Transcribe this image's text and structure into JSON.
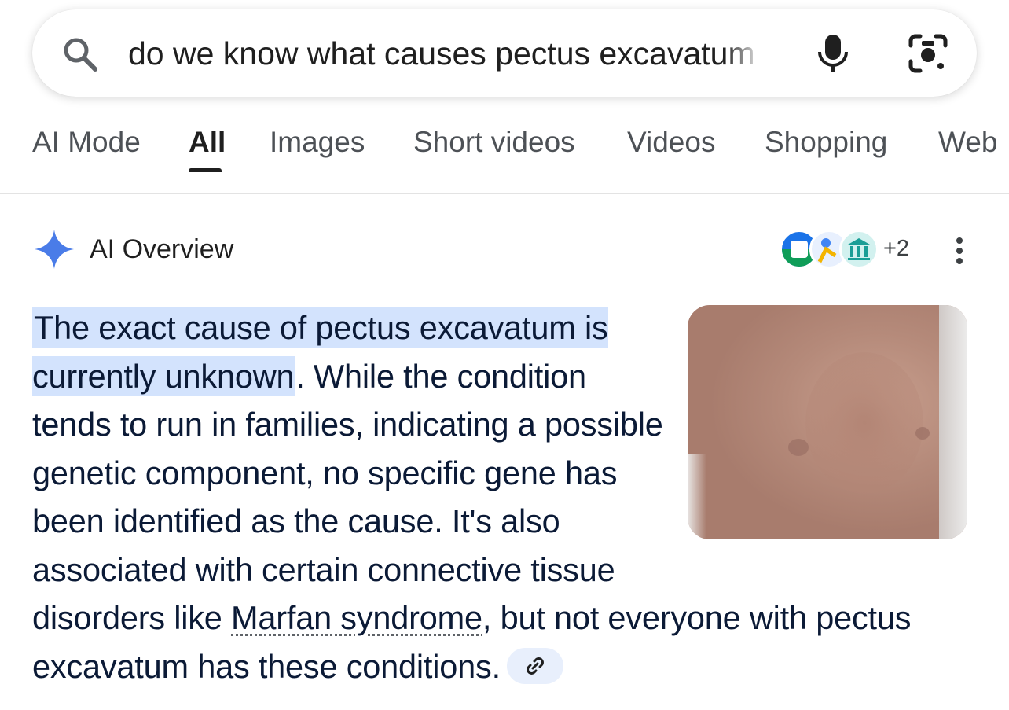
{
  "search": {
    "query": "do we know what causes pectus excavatum",
    "search_icon": "search-icon",
    "mic_icon": "microphone-icon",
    "lens_icon": "camera-lens-icon"
  },
  "tabs": [
    {
      "label": "AI Mode",
      "active": false
    },
    {
      "label": "All",
      "active": true
    },
    {
      "label": "Images",
      "active": false
    },
    {
      "label": "Short videos",
      "active": false
    },
    {
      "label": "Videos",
      "active": false
    },
    {
      "label": "Shopping",
      "active": false
    },
    {
      "label": "Web",
      "active": false
    }
  ],
  "ai_overview": {
    "title": "AI Overview",
    "sources_more": "+2",
    "highlighted_text": "The exact cause of pectus excavatum is currently unknown",
    "text_part1": ". While the condi­tion tends to run in families, indicating a possible genetic component, no specific gene has been identified as the cause. It's also associated with certain connec­tive tissue disorders like ",
    "link_text": "Marfan syndrome",
    "text_part2": ", but not every­one with pectus excavatum has these conditions.",
    "image_icon": "chest-photo",
    "link_chip_icon": "link-icon",
    "colors": {
      "highlight": "#d3e3fd",
      "spark": "#4a7ce8",
      "text": "#0b1a36"
    }
  }
}
